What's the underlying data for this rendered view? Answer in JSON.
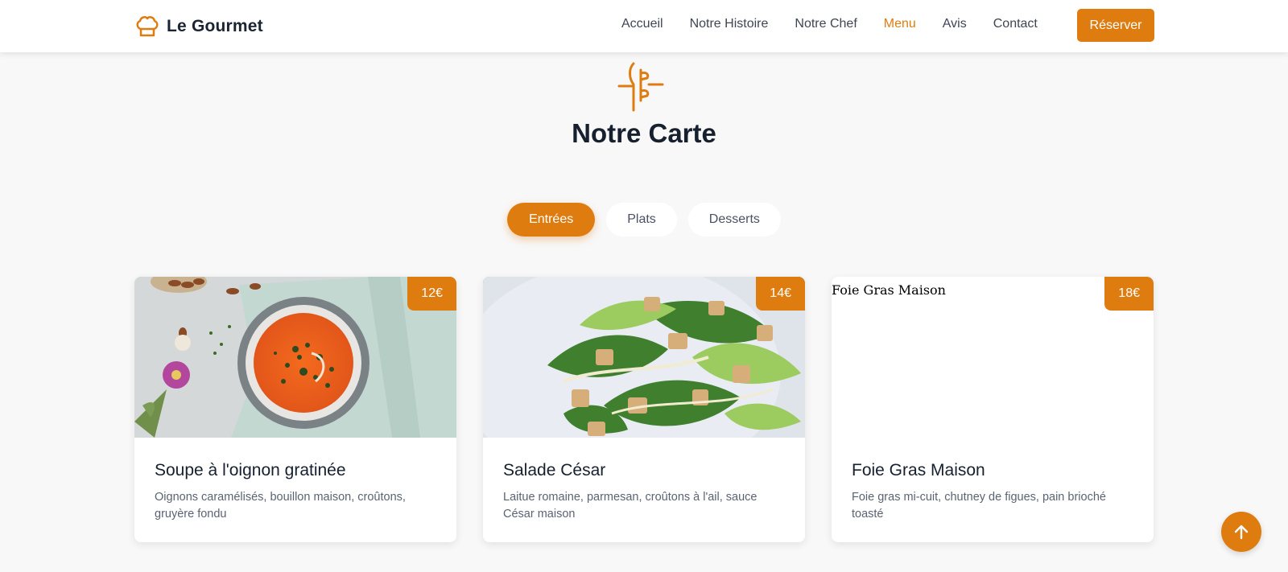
{
  "brand": {
    "name": "Le Gourmet",
    "icon": "chef-hat-icon"
  },
  "nav": {
    "items": [
      {
        "label": "Accueil",
        "active": false
      },
      {
        "label": "Notre Histoire",
        "active": false
      },
      {
        "label": "Notre Chef",
        "active": false
      },
      {
        "label": "Menu",
        "active": true
      },
      {
        "label": "Avis",
        "active": false
      },
      {
        "label": "Contact",
        "active": false
      }
    ],
    "reserve_label": "Réserver"
  },
  "section": {
    "icon": "utensils-icon",
    "title": "Notre Carte"
  },
  "tabs": [
    {
      "label": "Entrées",
      "active": true
    },
    {
      "label": "Plats",
      "active": false
    },
    {
      "label": "Desserts",
      "active": false
    }
  ],
  "dishes": [
    {
      "name": "Soupe à l'oignon gratinée",
      "description": "Oignons caramélisés, bouillon maison, croûtons, gruyère fondu",
      "price": "12€",
      "image": "tomato-soup-photo"
    },
    {
      "name": "Salade César",
      "description": "Laitue romaine, parmesan, croûtons à l'ail, sauce César maison",
      "price": "14€",
      "image": "caesar-salad-photo"
    },
    {
      "name": "Foie Gras Maison",
      "description": "Foie gras mi-cuit, chutney de figues, pain brioché toasté",
      "price": "18€",
      "image_alt": "Foie Gras Maison"
    }
  ],
  "colors": {
    "accent": "#df7c10",
    "background": "#f8f8f8",
    "heading": "#17202e"
  },
  "scroll_top_icon": "arrow-up-icon"
}
